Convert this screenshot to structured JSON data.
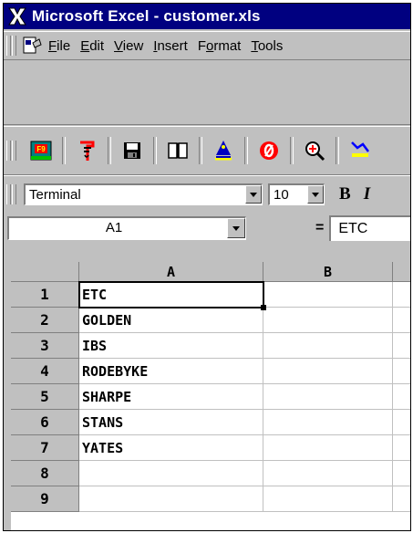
{
  "window": {
    "title": "Microsoft Excel - customer.xls"
  },
  "menu": {
    "items": [
      {
        "pre": "",
        "u": "F",
        "post": "ile"
      },
      {
        "pre": "",
        "u": "E",
        "post": "dit"
      },
      {
        "pre": "",
        "u": "V",
        "post": "iew"
      },
      {
        "pre": "",
        "u": "I",
        "post": "nsert"
      },
      {
        "pre": "F",
        "u": "o",
        "post": "rmat"
      },
      {
        "pre": "",
        "u": "T",
        "post": "ools"
      }
    ]
  },
  "toolbar": {
    "icons": [
      "f9-key-icon",
      "red-key-icon",
      "save-disk-icon",
      "book-icon",
      "wizard-icon",
      "no-zero-icon",
      "zoom-magnifier-icon",
      "chart-icon"
    ]
  },
  "format": {
    "font": "Terminal",
    "size": "10",
    "bold_label": "B",
    "italic_label": "I"
  },
  "formula": {
    "cell_ref": "A1",
    "equals": "=",
    "content": "ETC"
  },
  "grid": {
    "columns": [
      "A",
      "B"
    ],
    "rows": [
      {
        "num": "1",
        "a": "ETC"
      },
      {
        "num": "2",
        "a": "GOLDEN"
      },
      {
        "num": "3",
        "a": "IBS"
      },
      {
        "num": "4",
        "a": "RODEBYKE"
      },
      {
        "num": "5",
        "a": "SHARPE"
      },
      {
        "num": "6",
        "a": "STANS"
      },
      {
        "num": "7",
        "a": "YATES"
      },
      {
        "num": "8",
        "a": ""
      },
      {
        "num": "9",
        "a": ""
      }
    ]
  },
  "colors": {
    "title_bar": "#000080",
    "chrome": "#c0c0c0"
  }
}
